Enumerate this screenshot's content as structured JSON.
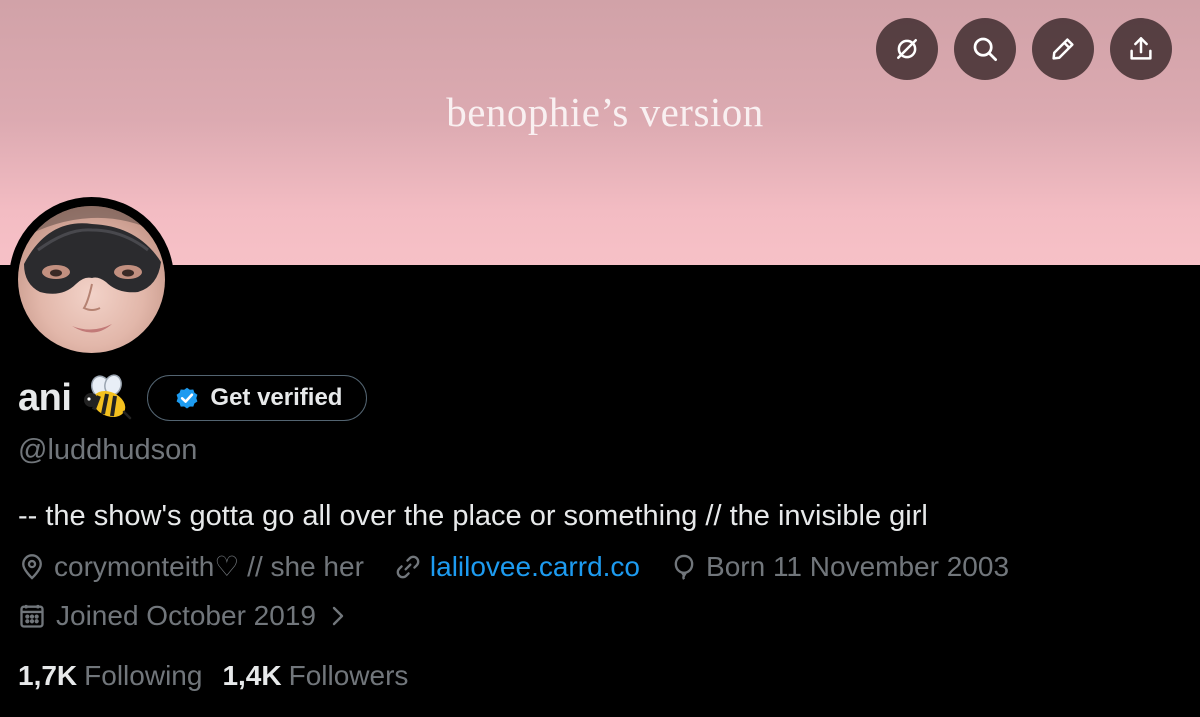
{
  "banner": {
    "text": "benophie’s version",
    "actions": [
      {
        "icon": "grok-icon"
      },
      {
        "icon": "search-icon"
      },
      {
        "icon": "edit-icon"
      },
      {
        "icon": "share-icon"
      }
    ]
  },
  "profile": {
    "display_name": "ani",
    "name_emoji": "bee-icon",
    "verify_label": "Get verified",
    "handle": "@luddhudson",
    "bio": "-- the show's gotta go all over the place or something // the invisible girl",
    "location": "corymonteith♡ // she her",
    "website": "lalilovee.carrd.co",
    "birthday": "Born 11 November 2003",
    "joined": "Joined October 2019",
    "following_count": "1,7K",
    "following_label": "Following",
    "followers_count": "1,4K",
    "followers_label": "Followers"
  },
  "colors": {
    "background": "#000000",
    "text_primary": "#e7e9ea",
    "text_secondary": "#71767b",
    "link": "#1d9bf0",
    "verified_badge": "#1d9bf0",
    "banner_top": "#d1a2a8",
    "banner_bottom": "#f7c1c7"
  }
}
